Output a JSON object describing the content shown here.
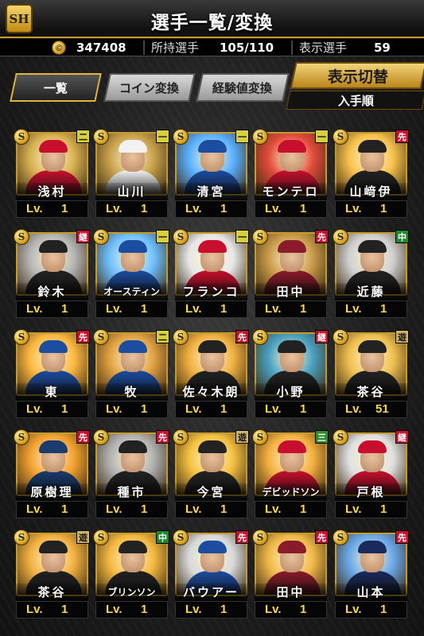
{
  "header": {
    "logo_text": "SH",
    "title": "選手一覧/変換"
  },
  "stats": {
    "coin_icon": "coin-icon",
    "coins": "347408",
    "owned_label": "所持選手",
    "owned_value": "105/110",
    "shown_label": "表示選手",
    "shown_value": "59"
  },
  "tabs": {
    "list": "一覧",
    "coin_convert": "コイン変換",
    "exp_convert": "経験値変換"
  },
  "display_switch": {
    "label": "表示切替",
    "sort": "入手順"
  },
  "colors": {
    "accent_gold": "#c79b2a",
    "level_text": "#ffd84a",
    "pos_pitcher": "#c8102e",
    "pos_infield": "#d3cf3a",
    "pos_outfield": "#1e8a2e",
    "pos_short": "#cfb36a",
    "pos_third": "#2f8d2f"
  },
  "players": [
    {
      "name": "浅村",
      "level": "1",
      "pos": "二",
      "pos_color": "#d6cf3f",
      "team": "#c8102e",
      "burst": "#d8b050"
    },
    {
      "name": "山川",
      "level": "1",
      "pos": "一",
      "pos_color": "#d6cf3f",
      "team": "#f2f2f2",
      "burst": "#c7a04a"
    },
    {
      "name": "清宮",
      "level": "1",
      "pos": "一",
      "pos_color": "#d6cf3f",
      "team": "#1c4da1",
      "burst": "#5ab0ff"
    },
    {
      "name": "モンテロ",
      "level": "1",
      "pos": "一",
      "pos_color": "#d6cf3f",
      "team": "#c8102e",
      "burst": "#e24b3a"
    },
    {
      "name": "山﨑伊",
      "level": "1",
      "pos": "先",
      "pos_color": "#c8102e",
      "team": "#222222",
      "burst": "#f7c04c"
    },
    {
      "name": "鈴木",
      "level": "1",
      "pos": "継",
      "pos_color": "#c8102e",
      "team": "#222222",
      "burst": "#b5b5b5"
    },
    {
      "name": "オースティン",
      "level": "1",
      "pos": "一",
      "pos_color": "#d6cf3f",
      "team": "#1c4da1",
      "burst": "#6fc0ff"
    },
    {
      "name": "フランコ",
      "level": "1",
      "pos": "一",
      "pos_color": "#d6cf3f",
      "team": "#c8102e",
      "burst": "#e6e6e6"
    },
    {
      "name": "田中",
      "level": "1",
      "pos": "先",
      "pos_color": "#c8102e",
      "team": "#8a1b2a",
      "burst": "#c89a48"
    },
    {
      "name": "近藤",
      "level": "1",
      "pos": "中",
      "pos_color": "#1e8a2e",
      "team": "#222222",
      "burst": "#cfcfcf"
    },
    {
      "name": "東",
      "level": "1",
      "pos": "先",
      "pos_color": "#c8102e",
      "team": "#1c4da1",
      "burst": "#ffb840"
    },
    {
      "name": "牧",
      "level": "1",
      "pos": "二",
      "pos_color": "#d6cf3f",
      "team": "#1c4da1",
      "burst": "#e0a040"
    },
    {
      "name": "佐々木朗",
      "level": "1",
      "pos": "先",
      "pos_color": "#c8102e",
      "team": "#222222",
      "burst": "#f0b040"
    },
    {
      "name": "小野",
      "level": "1",
      "pos": "継",
      "pos_color": "#c8102e",
      "team": "#222222",
      "burst": "#4aa0c0"
    },
    {
      "name": "茶谷",
      "level": "51",
      "pos": "遊",
      "pos_color": "#cfb36a",
      "team": "#222222",
      "burst": "#f0c050"
    },
    {
      "name": "原樹理",
      "level": "1",
      "pos": "先",
      "pos_color": "#c8102e",
      "team": "#1a3c6e",
      "burst": "#f2a030"
    },
    {
      "name": "種市",
      "level": "1",
      "pos": "先",
      "pos_color": "#c8102e",
      "team": "#222222",
      "burst": "#b0b0b0"
    },
    {
      "name": "今宮",
      "level": "1",
      "pos": "遊",
      "pos_color": "#cfb36a",
      "team": "#222222",
      "burst": "#f4c040"
    },
    {
      "name": "デビッドソン",
      "level": "1",
      "pos": "三",
      "pos_color": "#2f8d2f",
      "team": "#c8102e",
      "burst": "#f5b040"
    },
    {
      "name": "戸根",
      "level": "1",
      "pos": "継",
      "pos_color": "#c8102e",
      "team": "#c8102e",
      "burst": "#e0e0e0"
    },
    {
      "name": "茶谷",
      "level": "1",
      "pos": "遊",
      "pos_color": "#cfb36a",
      "team": "#222222",
      "burst": "#f2b040"
    },
    {
      "name": "ブリンソン",
      "level": "1",
      "pos": "中",
      "pos_color": "#1e8a2e",
      "team": "#222222",
      "burst": "#f4b840"
    },
    {
      "name": "バウアー",
      "level": "1",
      "pos": "先",
      "pos_color": "#c8102e",
      "team": "#1c4da1",
      "burst": "#d8d8d8"
    },
    {
      "name": "田中",
      "level": "1",
      "pos": "先",
      "pos_color": "#c8102e",
      "team": "#8a1b2a",
      "burst": "#f0b848"
    },
    {
      "name": "山本",
      "level": "1",
      "pos": "先",
      "pos_color": "#c8102e",
      "team": "#1a2a5a",
      "burst": "#6aa8e8"
    }
  ],
  "level_prefix": "Lv.",
  "s_icon_text": "S"
}
